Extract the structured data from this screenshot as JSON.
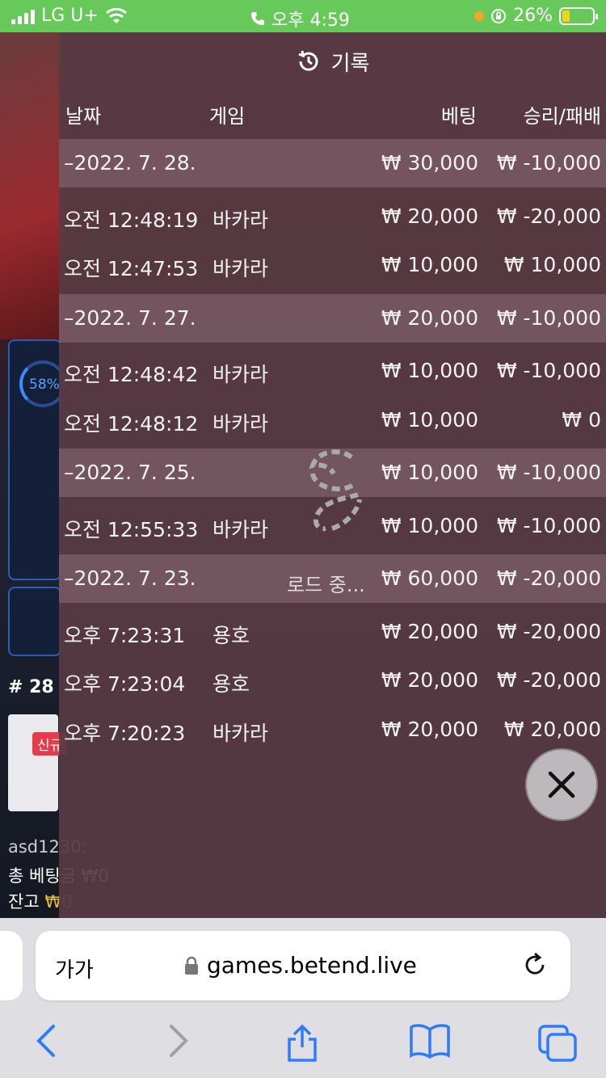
{
  "status_bar": {
    "carrier": "LG U+",
    "time": "오후 4:59",
    "battery": "26%",
    "battery_level": 0.26
  },
  "background": {
    "ring_percent": "58%",
    "label_number": "# 28",
    "badge": "신규",
    "username": "asd1230: ",
    "total_bet": "총 베팅금 ₩0",
    "balance_label": "잔고",
    "balance_value": "₩0"
  },
  "history": {
    "title": "기록",
    "columns": {
      "date": "날짜",
      "game": "게임",
      "bet": "베팅",
      "result": "승리/패배"
    },
    "rows": [
      {
        "date": "–2022. 7. 28.",
        "game": "",
        "bet": "₩ 30,000",
        "result": "₩ -10,000",
        "group": true
      },
      {
        "date": "오전 12:48:19",
        "game": "바카라",
        "bet": "₩ 20,000",
        "result": "₩ -20,000",
        "group": false
      },
      {
        "date": "오전 12:47:53",
        "game": "바카라",
        "bet": "₩ 10,000",
        "result": "₩ 10,000",
        "group": false
      },
      {
        "date": "–2022. 7. 27.",
        "game": "",
        "bet": "₩ 20,000",
        "result": "₩ -10,000",
        "group": true
      },
      {
        "date": "오전 12:48:42",
        "game": "바카라",
        "bet": "₩ 10,000",
        "result": "₩ -10,000",
        "group": false
      },
      {
        "date": "오전 12:48:12",
        "game": "바카라",
        "bet": "₩ 10,000",
        "result": "₩ 0",
        "group": false
      },
      {
        "date": "–2022. 7. 25.",
        "game": "",
        "bet": "₩ 10,000",
        "result": "₩ -10,000",
        "group": true
      },
      {
        "date": "오전 12:55:33",
        "game": "바카라",
        "bet": "₩ 10,000",
        "result": "₩ -10,000",
        "group": false
      },
      {
        "date": "–2022. 7. 23.",
        "game": "",
        "bet": "₩ 60,000",
        "result": "₩ -20,000",
        "group": true
      },
      {
        "date": "오후 7:23:31",
        "game": "용호",
        "bet": "₩ 20,000",
        "result": "₩ -20,000",
        "group": false
      },
      {
        "date": "오후 7:23:04",
        "game": "용호",
        "bet": "₩ 20,000",
        "result": "₩ -20,000",
        "group": false
      },
      {
        "date": "오후 7:20:23",
        "game": "바카라",
        "bet": "₩ 20,000",
        "result": "₩ 20,000",
        "group": false
      }
    ],
    "loading_text": "로드 중..."
  },
  "safari": {
    "aa_label": "가가",
    "url": "games.betend.live"
  },
  "icons": {
    "history": "history-clock-icon",
    "close": "close-icon",
    "lock": "lock-icon",
    "reload": "reload-icon",
    "back": "back-arrow-icon",
    "forward": "forward-arrow-icon",
    "share": "share-icon",
    "bookmarks": "bookmarks-icon",
    "tabs": "tabs-icon"
  },
  "colors": {
    "status_bar": "#66c95a",
    "overlay": "#583a44",
    "accent_blue": "#2f7cf6"
  }
}
